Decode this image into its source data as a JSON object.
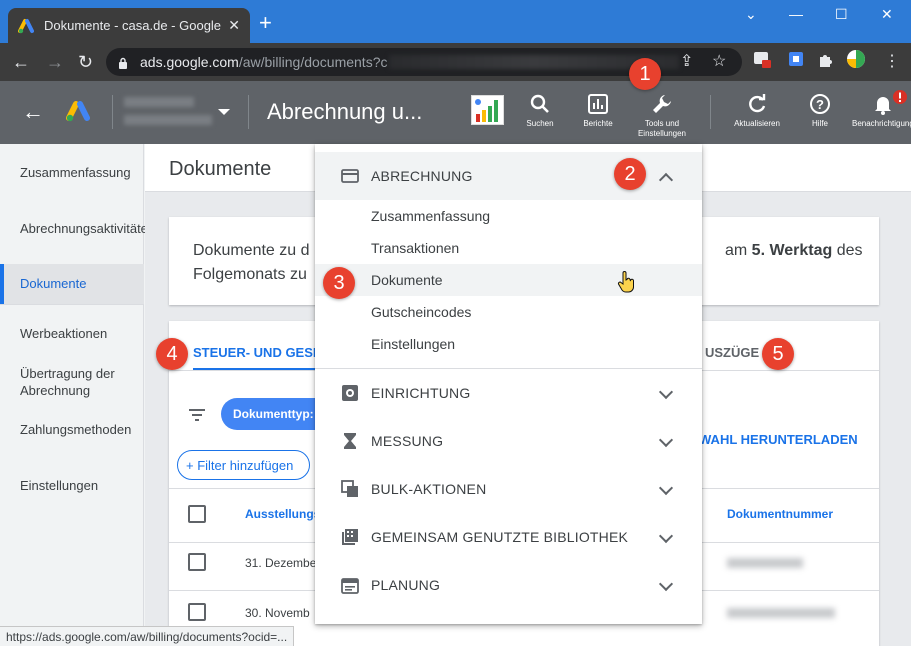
{
  "browser": {
    "tab_title": "Dokumente - casa.de - Google A",
    "tab_close": "✕",
    "new_tab": "+",
    "url_host": "ads.google.com",
    "url_path": "/aw/billing/documents?",
    "url_path_cont": "c",
    "status_url": "https://ads.google.com/aw/billing/documents?ocid=..."
  },
  "header": {
    "page_title": "Abrechnung u...",
    "buttons": {
      "search": "Suchen",
      "reports": "Berichte",
      "tools": "Tools und Einstellungen",
      "refresh": "Aktualisieren",
      "help": "Hilfe",
      "notifications": "Benachrichtigungen"
    }
  },
  "sidebar": {
    "items": [
      {
        "label": "Zusammenfassung"
      },
      {
        "label": "Abrechnungsaktivitäten"
      },
      {
        "label": "Dokumente"
      },
      {
        "label": "Werbeaktionen"
      },
      {
        "label": "Übertragung der Abrechnung"
      },
      {
        "label": "Zahlungsmethoden"
      },
      {
        "label": "Einstellungen"
      }
    ]
  },
  "main": {
    "title": "Dokumente",
    "info_left_1": "Dokumente zu d",
    "info_left_2": "Folgemonats zu",
    "info_right_1_pre": "am ",
    "info_right_1_bold": "5. Werktag",
    "info_right_1_post": " des",
    "tab_tax": "STEUER- UND GESE",
    "tab_statements": "USZÜGE",
    "chip": "Dokumenttyp:",
    "add_filter": "+ Filter hinzufügen",
    "download": "WAHL HERUNTERLADEN",
    "col_date": "Ausstellungs",
    "col_number": "Dokumentnummer",
    "rows": [
      {
        "date": "31. Dezembe"
      },
      {
        "date": "30. Novemb"
      }
    ]
  },
  "menu": {
    "billing": "ABRECHNUNG",
    "billing_items": [
      "Zusammenfassung",
      "Transaktionen",
      "Dokumente",
      "Gutscheincodes",
      "Einstellungen"
    ],
    "sections": [
      "EINRICHTUNG",
      "MESSUNG",
      "BULK-AKTIONEN",
      "GEMEINSAM GENUTZTE BIBLIOTHEK",
      "PLANUNG"
    ]
  },
  "markers": [
    "1",
    "2",
    "3",
    "4",
    "5"
  ],
  "colors": {
    "accent": "#1a73e8",
    "marker": "#e8412e",
    "header_bg": "#5f6368"
  }
}
